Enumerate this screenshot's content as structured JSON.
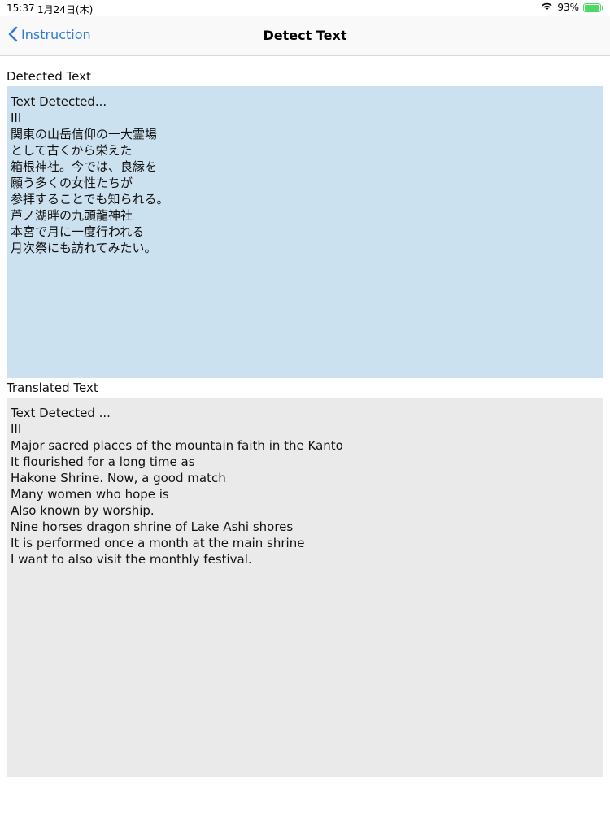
{
  "status_bar": {
    "time": "15:37",
    "date": "1月24日(木)",
    "wifi_icon": "wifi-icon",
    "battery_percent": "93%",
    "battery_level": 0.93,
    "battery_color": "#4cd964"
  },
  "nav": {
    "back_label": "Instruction",
    "title": "Detect Text",
    "accent_color": "#2f7ad6"
  },
  "detected": {
    "label": "Detected Text",
    "text": "Text Detected...\nIII\n関東の山岳信仰の一大霊場\nとして古くから栄えた\n箱根神社。今では、良縁を\n願う多くの女性たちが\n参拝することでも知られる。\n芦ノ湖畔の九頭龍神社\n本宮で月に一度行われる\n月次祭にも訪れてみたい。",
    "background": "#cce1f0"
  },
  "translated": {
    "label": "Translated Text",
    "text": "Text Detected ...\nIII\nMajor sacred places of the mountain faith in the Kanto\nIt flourished for a long time as\nHakone Shrine. Now, a good match\nMany women who hope is\nAlso known by worship.\nNine horses dragon shrine of Lake Ashi shores\nIt is performed once a month at the main shrine\nI want to also visit the monthly festival.",
    "background": "#eaeaea"
  }
}
